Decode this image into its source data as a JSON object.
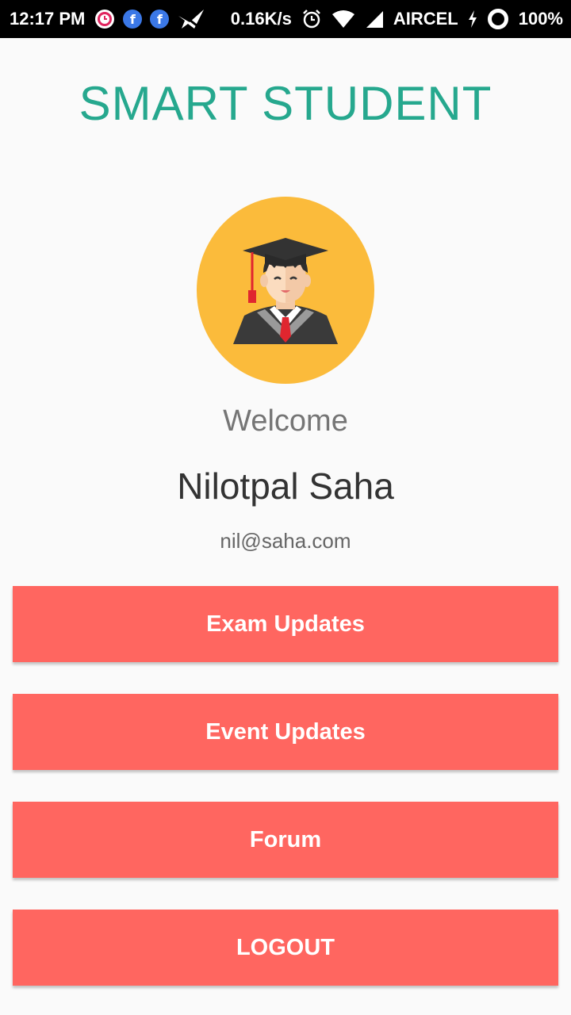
{
  "status_bar": {
    "time": "12:17 PM",
    "net_speed": "0.16K/s",
    "carrier": "AIRCEL",
    "battery": "100%",
    "fb_letter": "f"
  },
  "app": {
    "title": "SMART STUDENT"
  },
  "profile": {
    "welcome": "Welcome",
    "name": "Nilotpal Saha",
    "email": "nil@saha.com"
  },
  "menu": {
    "items": [
      {
        "label": "Exam Updates"
      },
      {
        "label": "Event Updates"
      },
      {
        "label": "Forum"
      },
      {
        "label": "LOGOUT"
      }
    ]
  },
  "colors": {
    "accent_title": "#26a88e",
    "button": "#ff6660",
    "avatar_bg": "#fbbb3b"
  },
  "icons": [
    "alarm-app-icon",
    "facebook-icon",
    "facebook-icon",
    "quiet-icon",
    "alarm-clock-icon",
    "wifi-icon",
    "signal-icon",
    "charging-icon",
    "battery-ring-icon",
    "graduate-avatar-icon"
  ]
}
